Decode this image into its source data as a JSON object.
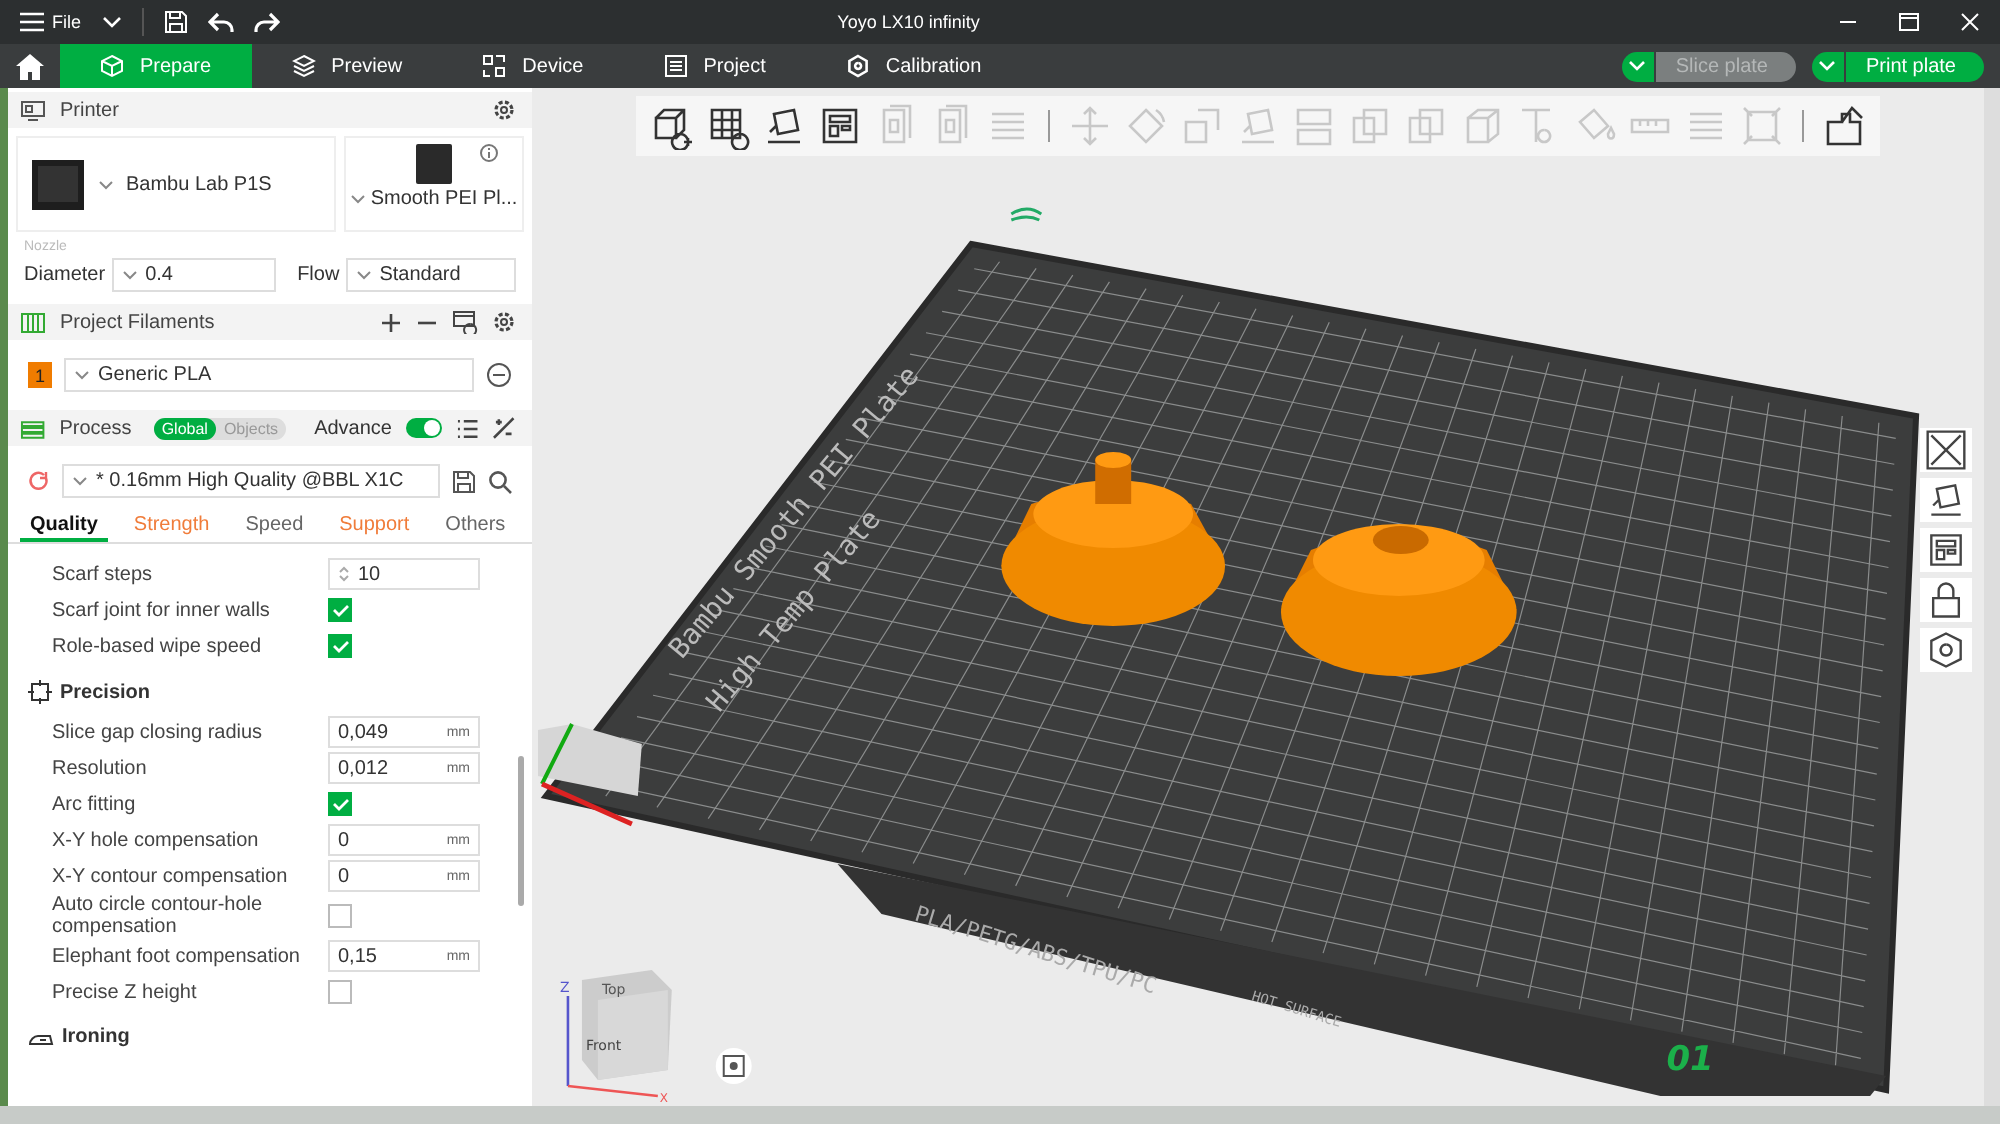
{
  "titlebar": {
    "menu": "File",
    "title": "Yoyo LX10 infinity"
  },
  "tabs": [
    {
      "label": "Prepare",
      "kind": "cube",
      "selected": true
    },
    {
      "label": "Preview",
      "kind": "layers",
      "selected": false
    },
    {
      "label": "Device",
      "kind": "device",
      "selected": false
    },
    {
      "label": "Project",
      "kind": "project",
      "selected": false
    },
    {
      "label": "Calibration",
      "kind": "gear",
      "selected": false
    }
  ],
  "actions": [
    {
      "label": "Slice plate",
      "disabled": true
    },
    {
      "label": "Print plate",
      "disabled": false
    }
  ],
  "printer": {
    "title": "Printer",
    "name": "Bambu Lab P1S",
    "plate": "Smooth PEI Pl...",
    "nozzle_label": "Nozzle",
    "diameter_label": "Diameter",
    "diameter": "0.4",
    "flow_label": "Flow",
    "flow": "Standard"
  },
  "filaments": {
    "title": "Project Filaments",
    "items": [
      {
        "index": "1",
        "name": "Generic PLA",
        "color": "#f07c00"
      }
    ]
  },
  "process": {
    "title": "Process",
    "scopes": [
      {
        "label": "Global",
        "selected": true
      },
      {
        "label": "Objects",
        "selected": false
      }
    ],
    "advance_label": "Advance",
    "advance": true,
    "preset": "* 0.16mm High Quality @BBL X1C"
  },
  "setting_tabs": [
    {
      "label": "Quality",
      "selected": true,
      "modified": false
    },
    {
      "label": "Strength",
      "selected": false,
      "modified": true
    },
    {
      "label": "Speed",
      "selected": false,
      "modified": false
    },
    {
      "label": "Support",
      "selected": false,
      "modified": true
    },
    {
      "label": "Others",
      "selected": false,
      "modified": false
    }
  ],
  "settings": [
    {
      "kind": "spin",
      "label": "Scarf steps",
      "value": "10"
    },
    {
      "kind": "check",
      "label": "Scarf joint for inner walls",
      "checked": true
    },
    {
      "kind": "check",
      "label": "Role-based wipe speed",
      "checked": true
    },
    {
      "kind": "section",
      "label": "Precision"
    },
    {
      "kind": "unit",
      "label": "Slice gap closing radius",
      "value": "0,049",
      "unit": "mm"
    },
    {
      "kind": "unit",
      "label": "Resolution",
      "value": "0,012",
      "unit": "mm"
    },
    {
      "kind": "check",
      "label": "Arc fitting",
      "checked": true
    },
    {
      "kind": "unit",
      "label": "X-Y hole compensation",
      "value": "0",
      "unit": "mm"
    },
    {
      "kind": "unit",
      "label": "X-Y contour compensation",
      "value": "0",
      "unit": "mm"
    },
    {
      "kind": "check",
      "label": "Auto circle contour-hole compensation",
      "checked": false
    },
    {
      "kind": "unit",
      "label": "Elephant foot compensation",
      "value": "0,15",
      "unit": "mm"
    },
    {
      "kind": "check",
      "label": "Precise Z height",
      "checked": false
    },
    {
      "kind": "section",
      "label": "Ironing"
    }
  ],
  "toolbar": [
    {
      "kind": "add-cube",
      "disabled": false
    },
    {
      "kind": "add-grid",
      "disabled": false
    },
    {
      "kind": "orient",
      "disabled": false
    },
    {
      "kind": "layout",
      "disabled": false
    },
    {
      "kind": "page",
      "disabled": true
    },
    {
      "kind": "page",
      "disabled": true
    },
    {
      "kind": "lines",
      "disabled": true
    },
    {
      "kind": "sep"
    },
    {
      "kind": "move",
      "disabled": true
    },
    {
      "kind": "rotate",
      "disabled": true
    },
    {
      "kind": "scale",
      "disabled": true
    },
    {
      "kind": "orient",
      "disabled": true
    },
    {
      "kind": "split",
      "disabled": true
    },
    {
      "kind": "squares",
      "disabled": true
    },
    {
      "kind": "squares",
      "disabled": true
    },
    {
      "kind": "cube",
      "disabled": true
    },
    {
      "kind": "text",
      "disabled": true
    },
    {
      "kind": "paint",
      "disabled": true
    },
    {
      "kind": "ruler",
      "disabled": true
    },
    {
      "kind": "lines",
      "disabled": true
    },
    {
      "kind": "frame",
      "disabled": true
    },
    {
      "kind": "sep"
    },
    {
      "kind": "puzzle",
      "disabled": false
    }
  ],
  "side_tools": [
    {
      "kind": "close"
    },
    {
      "kind": "orient"
    },
    {
      "kind": "layout"
    },
    {
      "kind": "lock"
    },
    {
      "kind": "gear"
    }
  ],
  "plate": {
    "labels": [
      "Bambu Smooth PEI Plate",
      "High Temp Plate"
    ],
    "materials": "PLA/PETG/ABS/TPU/PC",
    "warning": "HOT SURFACE",
    "number": "01"
  },
  "view_cube": {
    "top": "Top",
    "front": "Front",
    "z": "Z",
    "x": "X"
  }
}
